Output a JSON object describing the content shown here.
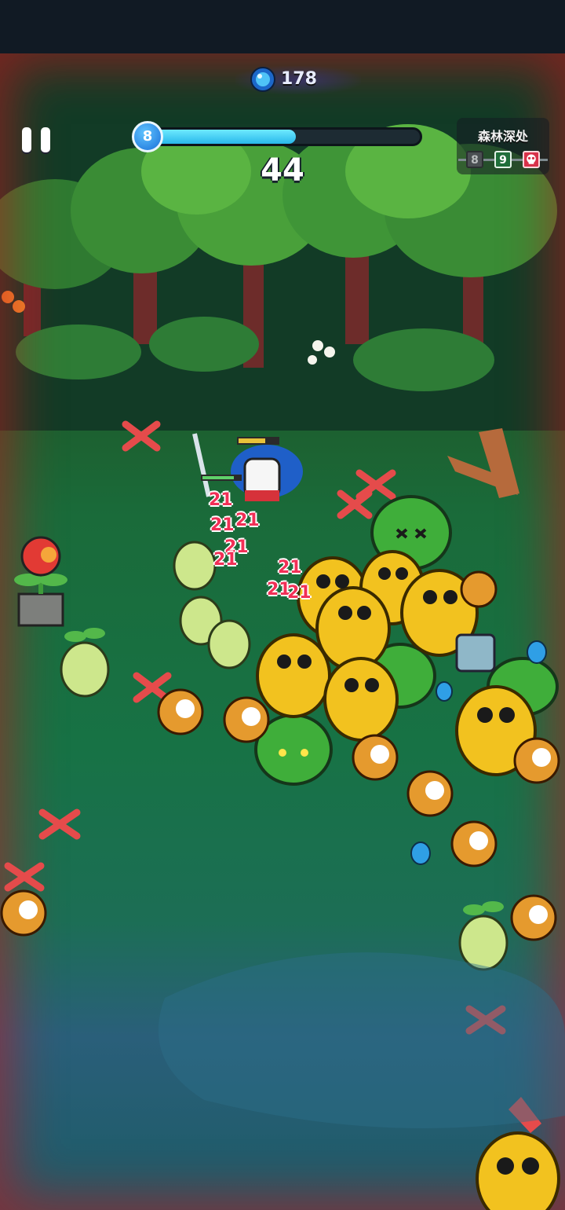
{
  "hud": {
    "gem_count": "178",
    "level": "8",
    "xp_fraction": 0.54,
    "wave_timer": "44",
    "stage_name": "森林深处",
    "stage_nodes": {
      "past": "8",
      "current": "9"
    }
  },
  "damage_numbers": [
    "21",
    "21",
    "21",
    "21",
    "21",
    "21",
    "21",
    "21"
  ],
  "colors": {
    "xp_fill": "#3fd0f5",
    "enemy_yellow": "#f2c21f",
    "bush_green": "#3fae3a",
    "gem_blue": "#2f9fe6",
    "danger_red": "#d8314a",
    "damage_text": "#f12f56"
  },
  "icons": {
    "currency": "blue-gem-icon",
    "pause": "pause-icon",
    "boss": "boss-skull-icon"
  }
}
